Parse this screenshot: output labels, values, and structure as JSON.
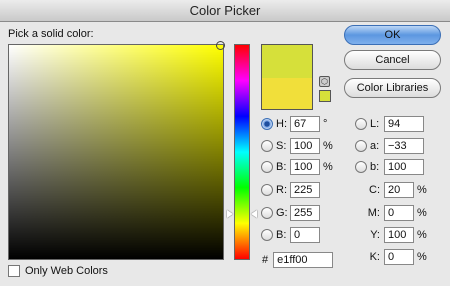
{
  "window": {
    "title": "Color Picker"
  },
  "prompt": "Pick a solid color:",
  "colors": {
    "new": "#d6e03a",
    "current": "#f1df3a",
    "gamut": "#d6e03a"
  },
  "buttons": {
    "ok": "OK",
    "cancel": "Cancel",
    "libraries": "Color Libraries"
  },
  "hsb": [
    {
      "label": "H:",
      "value": "67",
      "unit": "°",
      "selected": true
    },
    {
      "label": "S:",
      "value": "100",
      "unit": "%",
      "selected": false
    },
    {
      "label": "B:",
      "value": "100",
      "unit": "%",
      "selected": false
    }
  ],
  "rgb": [
    {
      "label": "R:",
      "value": "225"
    },
    {
      "label": "G:",
      "value": "255"
    },
    {
      "label": "B:",
      "value": "0"
    }
  ],
  "lab": [
    {
      "label": "L:",
      "value": "94"
    },
    {
      "label": "a:",
      "value": "−33"
    },
    {
      "label": "b:",
      "value": "100"
    }
  ],
  "cmyk": [
    {
      "label": "C:",
      "value": "20",
      "unit": "%"
    },
    {
      "label": "M:",
      "value": "0",
      "unit": "%"
    },
    {
      "label": "Y:",
      "value": "100",
      "unit": "%"
    },
    {
      "label": "K:",
      "value": "0",
      "unit": "%"
    }
  ],
  "hex": {
    "label": "#",
    "value": "e1ff00"
  },
  "web_only": {
    "label": "Only Web Colors",
    "checked": false
  }
}
